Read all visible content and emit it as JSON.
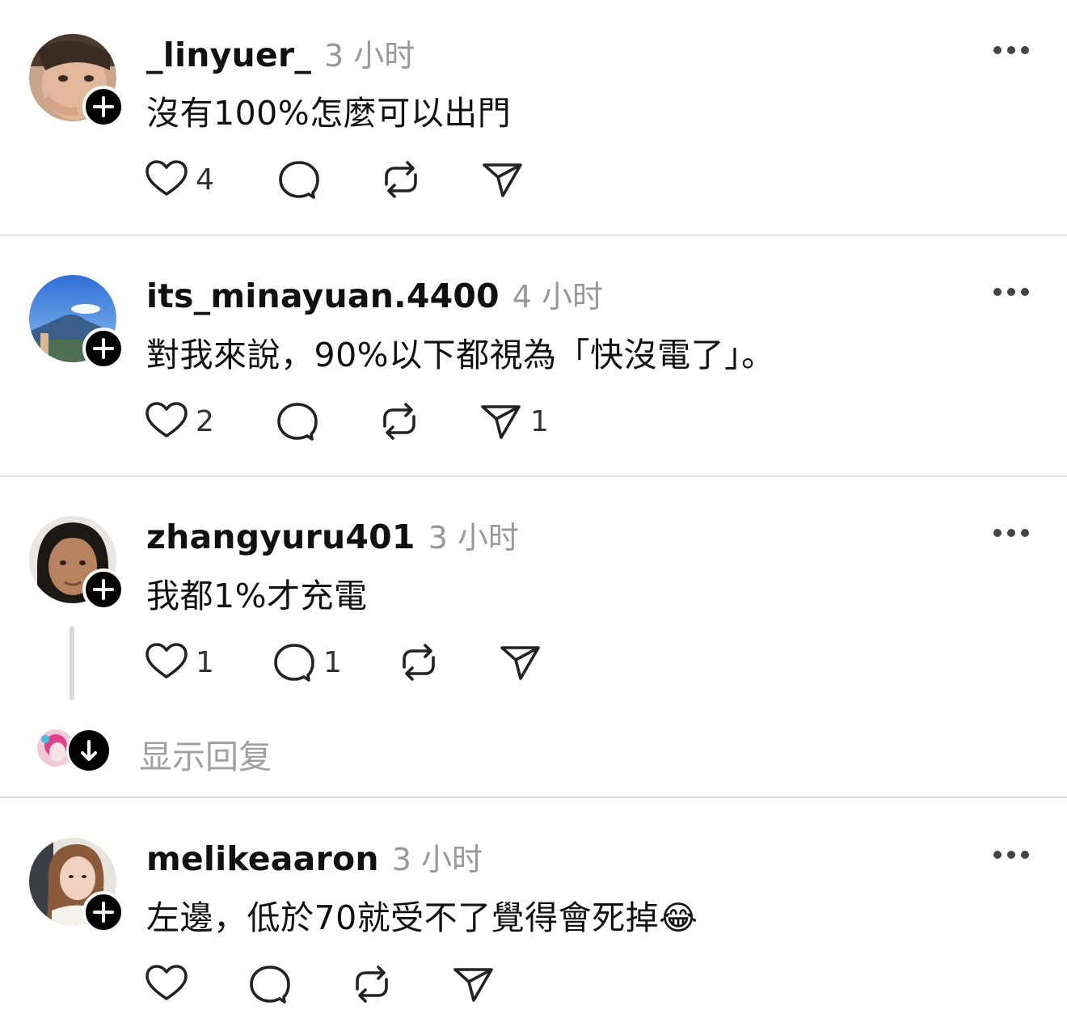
{
  "posts": [
    {
      "username": "_linyuer_",
      "time": "3 小时",
      "text": "沒有100%怎麼可以出門",
      "likes": "4",
      "comments": "",
      "shares": ""
    },
    {
      "username": "its_minayuan.4400",
      "time": "4 小时",
      "text": "對我來說，90%以下都視為「快沒電了」。",
      "likes": "2",
      "comments": "",
      "shares": "1"
    },
    {
      "username": "zhangyuru401",
      "time": "3 小时",
      "text": "我都1%才充電",
      "likes": "1",
      "comments": "1",
      "shares": ""
    },
    {
      "username": "melikeaaron",
      "time": "3 小时",
      "text": "左邊，低於70就受不了覺得會死掉😂",
      "likes": "",
      "comments": "",
      "shares": ""
    }
  ],
  "thread": {
    "show_replies": "显示回复"
  },
  "icons": [
    "more-icon",
    "heart-icon",
    "comment-icon",
    "repost-icon",
    "share-icon",
    "follow-plus-icon",
    "arrow-down-icon"
  ]
}
